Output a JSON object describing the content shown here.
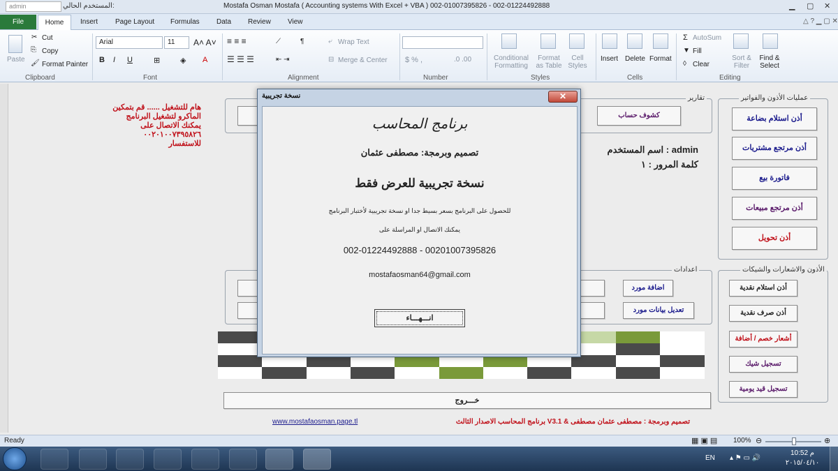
{
  "titlebar": {
    "input_value": "admin",
    "label": "المستخدم الحالي:",
    "title": "Mostafa Osman Mostafa   ( Accounting systems With Excel + VBA )  002-01007395826  -  002-01224492888"
  },
  "tabs": [
    "File",
    "Home",
    "Insert",
    "Page Layout",
    "Formulas",
    "Data",
    "Review",
    "View"
  ],
  "ribbon": {
    "clipboard": {
      "paste": "Paste",
      "cut": "Cut",
      "copy": "Copy",
      "format_painter": "Format Painter",
      "label": "Clipboard"
    },
    "font": {
      "name": "Arial",
      "size": "11",
      "label": "Font"
    },
    "alignment": {
      "wrap": "Wrap Text",
      "merge": "Merge & Center",
      "label": "Alignment"
    },
    "number": {
      "label": "Number"
    },
    "styles": {
      "cond": "Conditional Formatting",
      "table": "Format as Table",
      "cell": "Cell Styles",
      "label": "Styles"
    },
    "cells": {
      "insert": "Insert",
      "delete": "Delete",
      "format": "Format",
      "label": "Cells"
    },
    "editing": {
      "autosum": "AutoSum",
      "fill": "Fill",
      "clear": "Clear",
      "sort": "Sort & Filter",
      "find": "Find & Select",
      "label": "Editing"
    }
  },
  "sheet": {
    "warning": "هام للتشغيل ...... قم بتمكين الماكرو لتشغيل البرنامج يمكنك الاتصال على ٠٠٢٠١٠٠٧٣٩٥٨٢٦ للاستفسار",
    "reports_label": "تقارير",
    "accounts_btn": "كشوف حساب",
    "user_line": "اسم المستخدم : admin",
    "pass_line": "كلمة المرور : ١",
    "settings_label": "اعدادات",
    "add_supplier": "اضافة مورد",
    "edit_supplier": "تعديل بيانات مورد",
    "exit_btn": "خـــروج",
    "footer_url": "www.mostafaosman.page.tl",
    "footer_credit": "برنامج المحاسب الاصدار الثالث V3.1 & تصميم وبرمجة : مصطفى عثمان مصطفى",
    "ops_label": "عمليات الأذون والفواتير",
    "ops_buttons": [
      "أذن استلام بضاعة",
      "أذن مرتجع مشتريات",
      "فاتورة بيع",
      "أذن مرتجع  مبيعات",
      "أذن تحويل"
    ],
    "notes_label": "الأذون والاشعارات والشيكات",
    "notes_buttons": [
      "أذن استلام نقدية",
      "أذن صرف نقدية",
      "أشعار خصم / أضافة",
      "تسجيل شيك",
      "تسجيل قيد يومية"
    ],
    "pattern_colors": {
      "dark": "#4a4a4a",
      "white": "#ffffff",
      "green": "#7a9a3a",
      "lightgreen": "#c6d8a6"
    }
  },
  "dialog": {
    "title": "نسخة تجريبية",
    "app_name": "برنامج المحاسب",
    "credit": "تصميم وبرمجة: مصطفى عثمان",
    "trial": "نسخة تجريبية للعرض فقط",
    "info1": "للحصول على البرنامج بسعر بسيط جدا  او نسخة تجريبية لأختبار البرنامج",
    "info2": "يمكنك الاتصال  او المراسلة على",
    "phones": "002-01224492888  -  00201007395826",
    "email": "mostafaosman64@gmail.com",
    "ok": "انـــهـــاء"
  },
  "status": {
    "ready": "Ready",
    "zoom": "100%"
  },
  "taskbar": {
    "lang": "EN",
    "time": "10:52 م",
    "date": "٢٠١٥/٠٤/١٠"
  }
}
